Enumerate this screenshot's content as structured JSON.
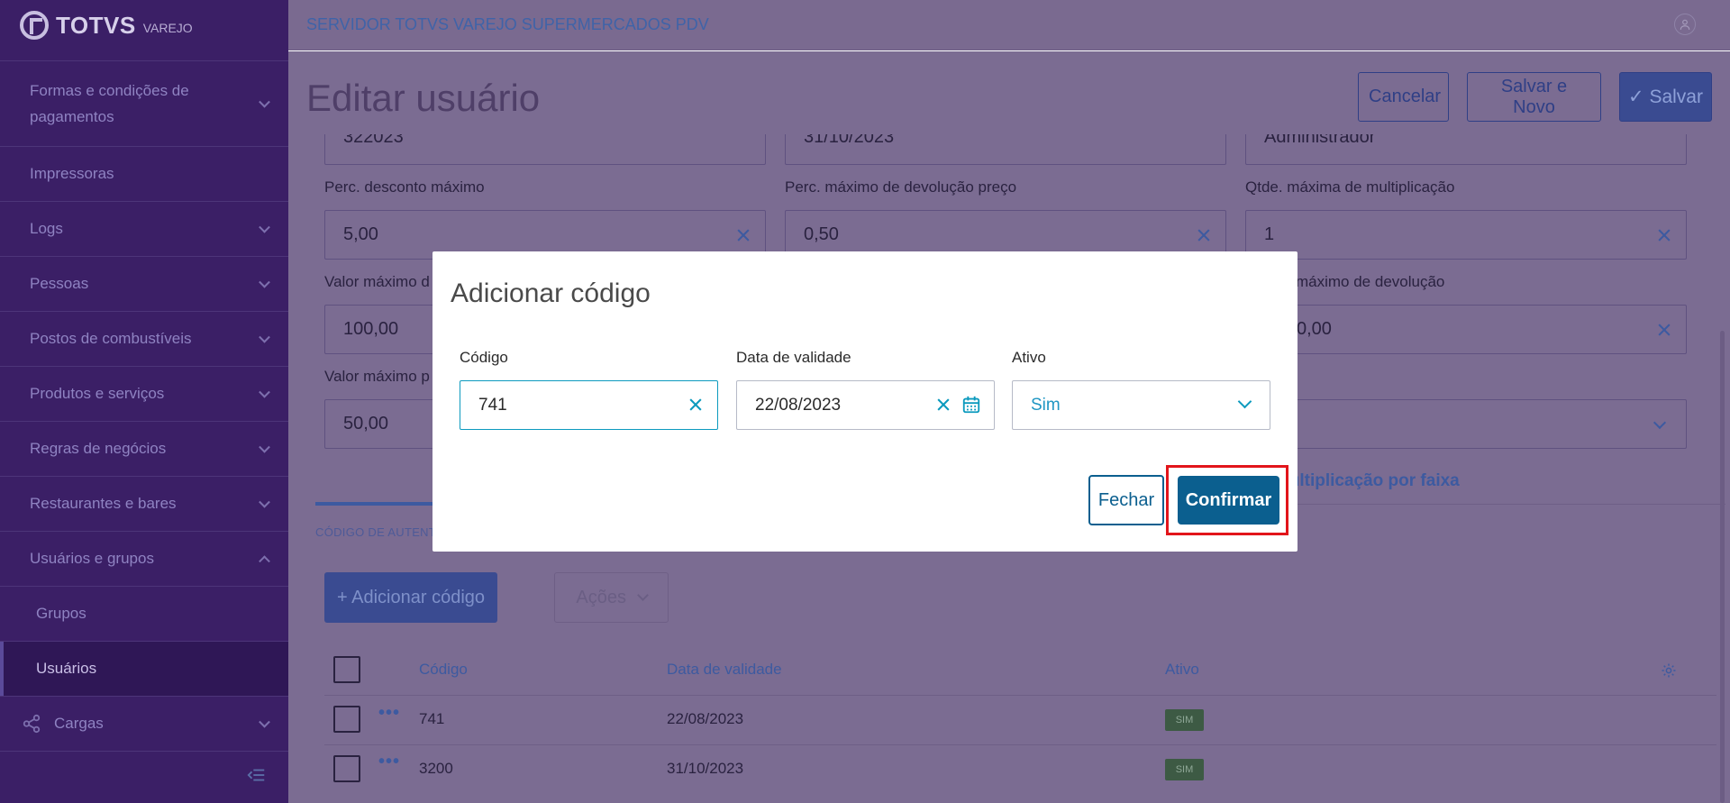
{
  "brand": {
    "name": "TOTVS",
    "sub": "VAREJO"
  },
  "sidebar": {
    "items": [
      {
        "label": "Formas e condições de pagamentos",
        "expanded": false
      },
      {
        "label": "Impressoras"
      },
      {
        "label": "Logs",
        "expanded": false
      },
      {
        "label": "Pessoas",
        "expanded": false
      },
      {
        "label": "Postos de combustíveis",
        "expanded": false
      },
      {
        "label": "Produtos e serviços",
        "expanded": false
      },
      {
        "label": "Regras de negócios",
        "expanded": false
      },
      {
        "label": "Restaurantes e bares",
        "expanded": false
      },
      {
        "label": "Usuários e grupos",
        "expanded": true
      },
      {
        "label": "Grupos"
      },
      {
        "label": "Usuários",
        "active": true
      },
      {
        "label": "Cargas",
        "expanded": false
      }
    ]
  },
  "header": {
    "server": "SERVIDOR TOTVS VAREJO SUPERMERCADOS PDV"
  },
  "page": {
    "title": "Editar usuário",
    "cancel_label": "Cancelar",
    "save_new_label": "Salvar e Novo",
    "save_label": "✓ Salvar"
  },
  "form": {
    "row0": {
      "a": "322023",
      "b": "31/10/2023",
      "c": "Administrador"
    },
    "perc_desconto": {
      "label": "Perc. desconto máximo",
      "value": "5,00"
    },
    "perc_devolucao": {
      "label": "Perc. máximo de devolução preço",
      "value": "0,50"
    },
    "qtde_mult": {
      "label": "Qtde. máxima de multiplicação",
      "value": "1"
    },
    "valor_max_a": {
      "label": "Valor máximo d",
      "value": "100,00"
    },
    "valor_devolucao": {
      "label": "máximo de devolução",
      "value": "0,00"
    },
    "valor_max_b": {
      "label": "Valor máximo p",
      "value": "50,00"
    },
    "mult_link": "a multiplicação por faixa"
  },
  "tabs": {
    "active": "CÓDIGO DE AUTENTIC"
  },
  "actions": {
    "add_code": "+ Adicionar código",
    "acoes": "Ações"
  },
  "table": {
    "headers": {
      "codigo": "Código",
      "validade": "Data de validade",
      "ativo": "Ativo"
    },
    "rows": [
      {
        "codigo": "741",
        "validade": "22/08/2023",
        "ativo": "SIM"
      },
      {
        "codigo": "3200",
        "validade": "31/10/2023",
        "ativo": "SIM"
      }
    ]
  },
  "modal": {
    "title": "Adicionar código",
    "codigo": {
      "label": "Código",
      "value": "741"
    },
    "validade": {
      "label": "Data de validade",
      "value": "22/08/2023"
    },
    "ativo": {
      "label": "Ativo",
      "value": "Sim"
    },
    "fechar": "Fechar",
    "confirmar": "Confirmar"
  },
  "colors": {
    "primary": "#0b5f8f",
    "accent": "#0c9abe",
    "highlight": "#e2151b"
  }
}
